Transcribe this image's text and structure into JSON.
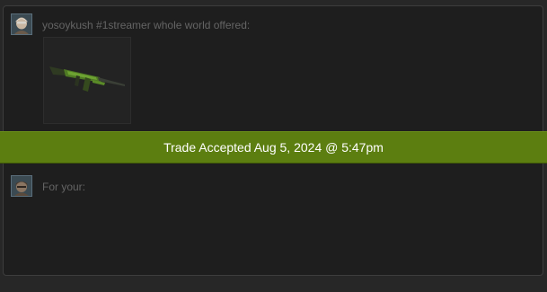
{
  "offer": {
    "header": "yosoykush #1streamer whole world offered:",
    "item_icon": "assault-rifle-green-skin-icon",
    "avatar_icon": "user-avatar-icon"
  },
  "status": {
    "banner_text": "Trade Accepted Aug 5, 2024 @ 5:47pm",
    "color": "#5c7e10"
  },
  "receive": {
    "header": "For your:",
    "avatar_icon": "user-avatar-icon"
  }
}
